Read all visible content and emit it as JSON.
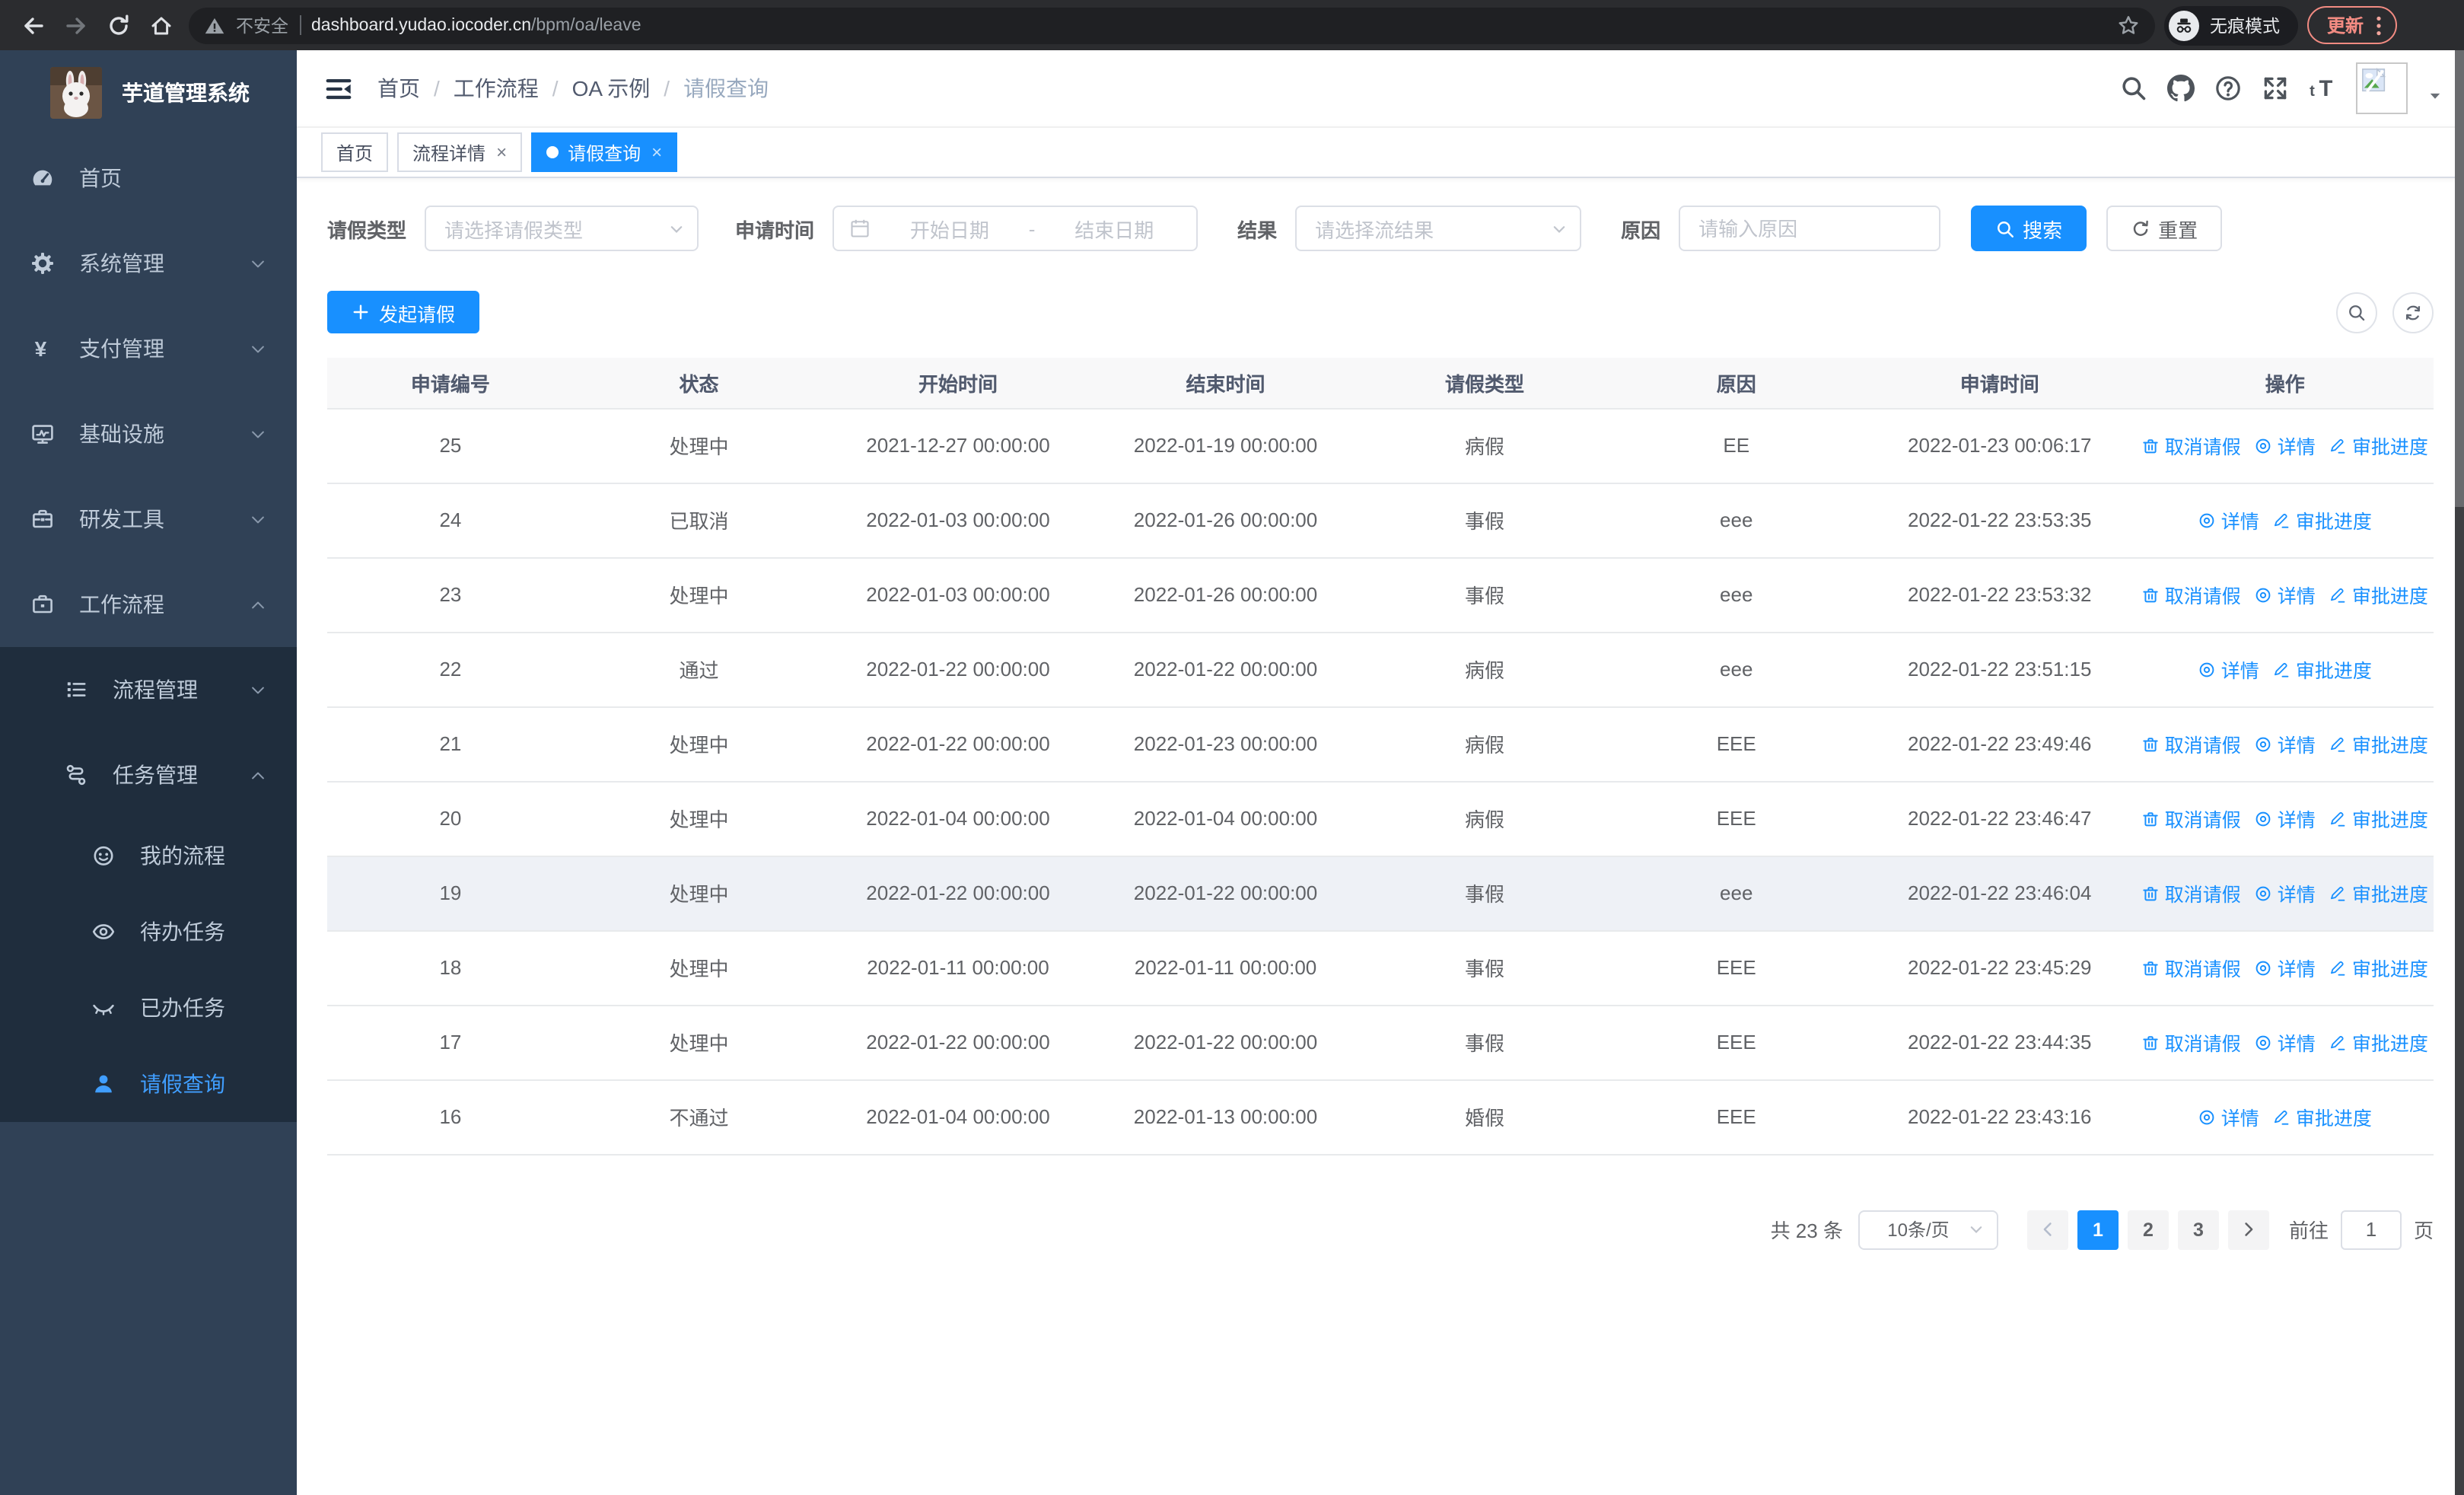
{
  "colors": {
    "primary": "#1890ff",
    "link": "#1890ff",
    "sidebar-bg": "#304156",
    "submenu-bg": "#1f2d3d",
    "sidebar-active": "#409eff",
    "sidebar-text": "#bfcbd9",
    "update-accent": "#f28b82"
  },
  "browser": {
    "nav_icons": [
      "back-icon",
      "forward-icon",
      "reload-icon",
      "home-icon"
    ],
    "security_label": "不安全",
    "url_host": "dashboard.yudao.iocoder.cn",
    "url_path": "/bpm/oa/leave",
    "incognito_label": "无痕模式",
    "update_label": "更新"
  },
  "sidebar": {
    "title": "芋道管理系统",
    "items": [
      {
        "label": "首页",
        "icon": "dashboard-icon",
        "level": 1
      },
      {
        "label": "系统管理",
        "icon": "gear-icon",
        "level": 1,
        "arrow": "down"
      },
      {
        "label": "支付管理",
        "icon": "yen-icon",
        "level": 1,
        "arrow": "down"
      },
      {
        "label": "基础设施",
        "icon": "monitor-icon",
        "level": 1,
        "arrow": "down"
      },
      {
        "label": "研发工具",
        "icon": "toolbox-icon",
        "level": 1,
        "arrow": "down"
      },
      {
        "label": "工作流程",
        "icon": "briefcase-icon",
        "level": 1,
        "arrow": "up"
      },
      {
        "label": "流程管理",
        "icon": "list-tree-icon",
        "level": 2,
        "arrow": "down",
        "submenu": true
      },
      {
        "label": "任务管理",
        "icon": "flow-icon",
        "level": 2,
        "arrow": "up",
        "submenu": true
      },
      {
        "label": "我的流程",
        "icon": "robot-icon",
        "level": 3,
        "submenu": true
      },
      {
        "label": "待办任务",
        "icon": "eye-open-icon",
        "level": 3,
        "submenu": true
      },
      {
        "label": "已办任务",
        "icon": "eye-closed-icon",
        "level": 3,
        "submenu": true
      },
      {
        "label": "请假查询",
        "icon": "user-icon",
        "level": 3,
        "submenu": true,
        "active": true
      }
    ]
  },
  "header": {
    "breadcrumb": [
      "首页",
      "工作流程",
      "OA 示例",
      "请假查询"
    ],
    "icons": [
      "search-icon",
      "github-icon",
      "help-icon",
      "fullscreen-icon",
      "font-size-icon"
    ]
  },
  "ui": {
    "close_glyph": "×",
    "breadcrumb_separator": "/"
  },
  "tabs": [
    {
      "label": "首页",
      "closable": false,
      "active": false
    },
    {
      "label": "流程详情",
      "closable": true,
      "active": false
    },
    {
      "label": "请假查询",
      "closable": true,
      "active": true
    }
  ],
  "filters": {
    "leave_type_label": "请假类型",
    "leave_type_placeholder": "请选择请假类型",
    "apply_time_label": "申请时间",
    "date_start_placeholder": "开始日期",
    "date_separator": "-",
    "date_end_placeholder": "结束日期",
    "result_label": "结果",
    "result_placeholder": "请选择流结果",
    "reason_label": "原因",
    "reason_placeholder": "请输入原因",
    "search_label": "搜索",
    "reset_label": "重置"
  },
  "toolbar": {
    "create_label": "发起请假"
  },
  "table": {
    "columns": [
      "申请编号",
      "状态",
      "开始时间",
      "结束时间",
      "请假类型",
      "原因",
      "申请时间",
      "操作"
    ],
    "action_labels": {
      "cancel": "取消请假",
      "detail": "详情",
      "progress": "审批进度"
    },
    "rows": [
      {
        "id": "25",
        "status": "处理中",
        "start": "2021-12-27 00:00:00",
        "end": "2022-01-19 00:00:00",
        "type": "病假",
        "reason": "EE",
        "applied": "2022-01-23 00:06:17",
        "cancelable": true
      },
      {
        "id": "24",
        "status": "已取消",
        "start": "2022-01-03 00:00:00",
        "end": "2022-01-26 00:00:00",
        "type": "事假",
        "reason": "eee",
        "applied": "2022-01-22 23:53:35",
        "cancelable": false
      },
      {
        "id": "23",
        "status": "处理中",
        "start": "2022-01-03 00:00:00",
        "end": "2022-01-26 00:00:00",
        "type": "事假",
        "reason": "eee",
        "applied": "2022-01-22 23:53:32",
        "cancelable": true
      },
      {
        "id": "22",
        "status": "通过",
        "start": "2022-01-22 00:00:00",
        "end": "2022-01-22 00:00:00",
        "type": "病假",
        "reason": "eee",
        "applied": "2022-01-22 23:51:15",
        "cancelable": false
      },
      {
        "id": "21",
        "status": "处理中",
        "start": "2022-01-22 00:00:00",
        "end": "2022-01-23 00:00:00",
        "type": "病假",
        "reason": "EEE",
        "applied": "2022-01-22 23:49:46",
        "cancelable": true
      },
      {
        "id": "20",
        "status": "处理中",
        "start": "2022-01-04 00:00:00",
        "end": "2022-01-04 00:00:00",
        "type": "病假",
        "reason": "EEE",
        "applied": "2022-01-22 23:46:47",
        "cancelable": true
      },
      {
        "id": "19",
        "status": "处理中",
        "start": "2022-01-22 00:00:00",
        "end": "2022-01-22 00:00:00",
        "type": "事假",
        "reason": "eee",
        "applied": "2022-01-22 23:46:04",
        "cancelable": true,
        "highlighted": true
      },
      {
        "id": "18",
        "status": "处理中",
        "start": "2022-01-11 00:00:00",
        "end": "2022-01-11 00:00:00",
        "type": "事假",
        "reason": "EEE",
        "applied": "2022-01-22 23:45:29",
        "cancelable": true
      },
      {
        "id": "17",
        "status": "处理中",
        "start": "2022-01-22 00:00:00",
        "end": "2022-01-22 00:00:00",
        "type": "事假",
        "reason": "EEE",
        "applied": "2022-01-22 23:44:35",
        "cancelable": true
      },
      {
        "id": "16",
        "status": "不通过",
        "start": "2022-01-04 00:00:00",
        "end": "2022-01-13 00:00:00",
        "type": "婚假",
        "reason": "EEE",
        "applied": "2022-01-22 23:43:16",
        "cancelable": false
      }
    ]
  },
  "pagination": {
    "total_label": "共 23 条",
    "page_size": "10条/页",
    "pages": [
      "1",
      "2",
      "3"
    ],
    "active_page": "1",
    "goto_label": "前往",
    "goto_value": "1",
    "page_suffix_label": "页"
  }
}
